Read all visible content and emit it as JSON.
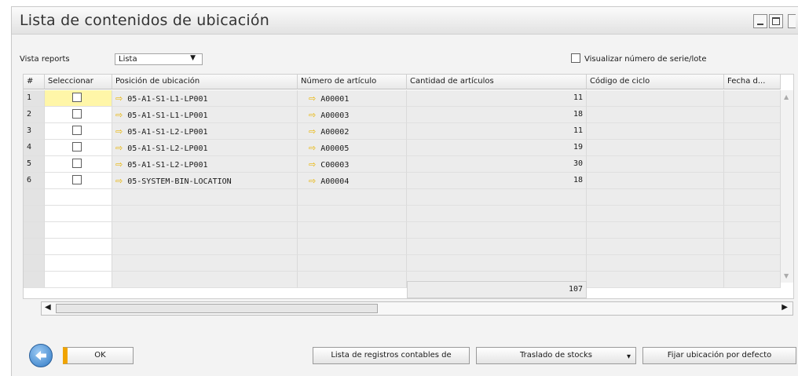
{
  "window": {
    "title": "Lista de contenidos de ubicación"
  },
  "toolbar": {
    "view_label": "Vista reports",
    "view_value": "Lista",
    "serial_label": "Visualizar número de serie/lote"
  },
  "grid": {
    "headers": [
      "#",
      "Seleccionar",
      "Posición de ubicación",
      "Número de artículo",
      "Cantidad de artículos",
      "Código de ciclo",
      "Fecha d..."
    ],
    "rows": [
      {
        "num": "1",
        "location": "05-A1-S1-L1-LP001",
        "item": "A00001",
        "qty": "11"
      },
      {
        "num": "2",
        "location": "05-A1-S1-L1-LP001",
        "item": "A00003",
        "qty": "18"
      },
      {
        "num": "3",
        "location": "05-A1-S1-L2-LP001",
        "item": "A00002",
        "qty": "11"
      },
      {
        "num": "4",
        "location": "05-A1-S1-L2-LP001",
        "item": "A00005",
        "qty": "19"
      },
      {
        "num": "5",
        "location": "05-A1-S1-L2-LP001",
        "item": "C00003",
        "qty": "30"
      },
      {
        "num": "6",
        "location": "05-SYSTEM-BIN-LOCATION",
        "item": "A00004",
        "qty": "18"
      }
    ],
    "total": "107"
  },
  "buttons": {
    "ok": "OK",
    "journal": "Lista de registros contables de",
    "transfer": "Traslado de stocks",
    "default_bin": "Fijar ubicación por defecto"
  },
  "colors": {
    "accent": "#f0a400",
    "arrow": "#e8b400"
  }
}
